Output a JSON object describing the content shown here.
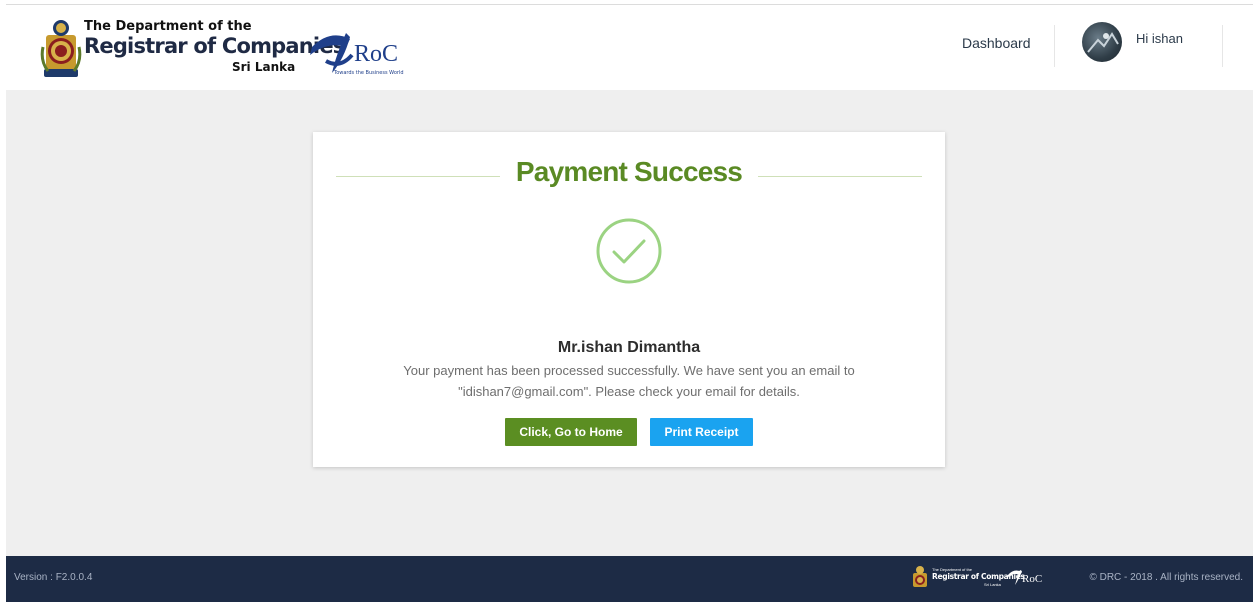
{
  "header": {
    "brand_line1": "The Department of the",
    "brand_line2": "Registrar of Companies",
    "brand_line3": "Sri Lanka",
    "eroc_logo": "RoC",
    "eroc_tagline": "Towards the Business World",
    "nav_dashboard": "Dashboard",
    "greeting": "Hi ishan"
  },
  "card": {
    "title": "Payment Success",
    "icon": "check-circle-icon",
    "name": "Mr.ishan Dimantha",
    "message_line1": "Your payment has been processed successfully. We have sent you an email to",
    "message_line2": "\"idishan7@gmail.com\". Please check your email for details.",
    "home_button": "Click, Go to Home",
    "print_button": "Print Receipt"
  },
  "footer": {
    "version": "Version : F2.0.0.4",
    "brand_line1": "The Department of the",
    "brand_line2": "Registrar of Companies",
    "brand_line3": "Sri Lanka",
    "eroc_logo": "RoC",
    "copyright": "© DRC - 2018 . All rights reserved."
  },
  "colors": {
    "accent_green": "#5a8a24",
    "button_green": "#5b8e22",
    "button_blue": "#1aa3f0",
    "footer_bg": "#1d2b45",
    "page_bg": "#efefef"
  }
}
